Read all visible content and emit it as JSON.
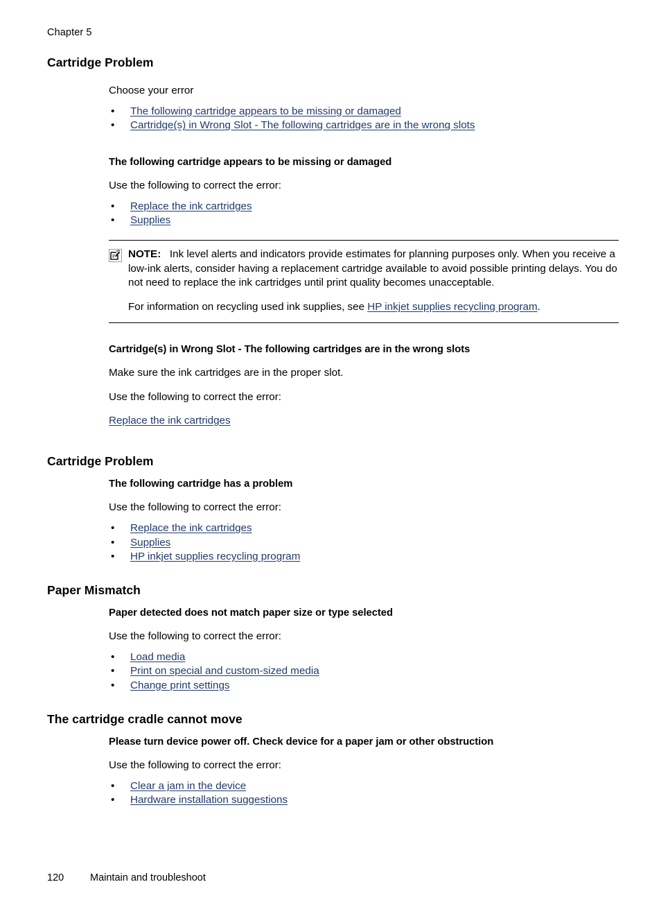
{
  "running_head": "Chapter 5",
  "link_color": "#1f3a68",
  "sections": {
    "cartridge_problem_1": {
      "title": "Cartridge Problem",
      "intro": "Choose your error",
      "choices": [
        "The following cartridge appears to be missing or damaged",
        "Cartridge(s) in Wrong Slot - The following cartridges are in the wrong slots"
      ],
      "sub_a": {
        "heading": "The following cartridge appears to be missing or damaged",
        "instruction": "Use the following to correct the error:",
        "links": [
          "Replace the ink cartridges",
          "Supplies"
        ]
      },
      "note": {
        "icon": "note-pencil-icon",
        "label": "NOTE:",
        "body": "Ink level alerts and indicators provide estimates for planning purposes only. When you receive a low-ink alerts, consider having a replacement cartridge available to avoid possible printing delays. You do not need to replace the ink cartridges until print quality becomes unacceptable.",
        "recycling_prefix": "For information on recycling used ink supplies, see ",
        "recycling_link": "HP inkjet supplies recycling program",
        "recycling_suffix": "."
      },
      "sub_b": {
        "heading": "Cartridge(s) in Wrong Slot - The following cartridges are in the wrong slots",
        "paragraph": "Make sure the ink cartridges are in the proper slot.",
        "instruction": "Use the following to correct the error:",
        "link": "Replace the ink cartridges"
      }
    },
    "cartridge_problem_2": {
      "title": "Cartridge Problem",
      "heading": "The following cartridge has a problem",
      "instruction": "Use the following to correct the error:",
      "links": [
        "Replace the ink cartridges",
        "Supplies",
        "HP inkjet supplies recycling program"
      ]
    },
    "paper_mismatch": {
      "title": "Paper Mismatch",
      "heading": "Paper detected does not match paper size or type selected",
      "instruction": "Use the following to correct the error:",
      "links": [
        "Load media",
        "Print on special and custom-sized media",
        "Change print settings"
      ]
    },
    "cradle": {
      "title": "The cartridge cradle cannot move",
      "heading": "Please turn device power off. Check device for a paper jam or other obstruction",
      "instruction": "Use the following to correct the error:",
      "links": [
        "Clear a jam in the device",
        "Hardware installation suggestions"
      ]
    }
  },
  "footer": {
    "page_number": "120",
    "section_name": "Maintain and troubleshoot"
  },
  "bullet_glyph": "•"
}
